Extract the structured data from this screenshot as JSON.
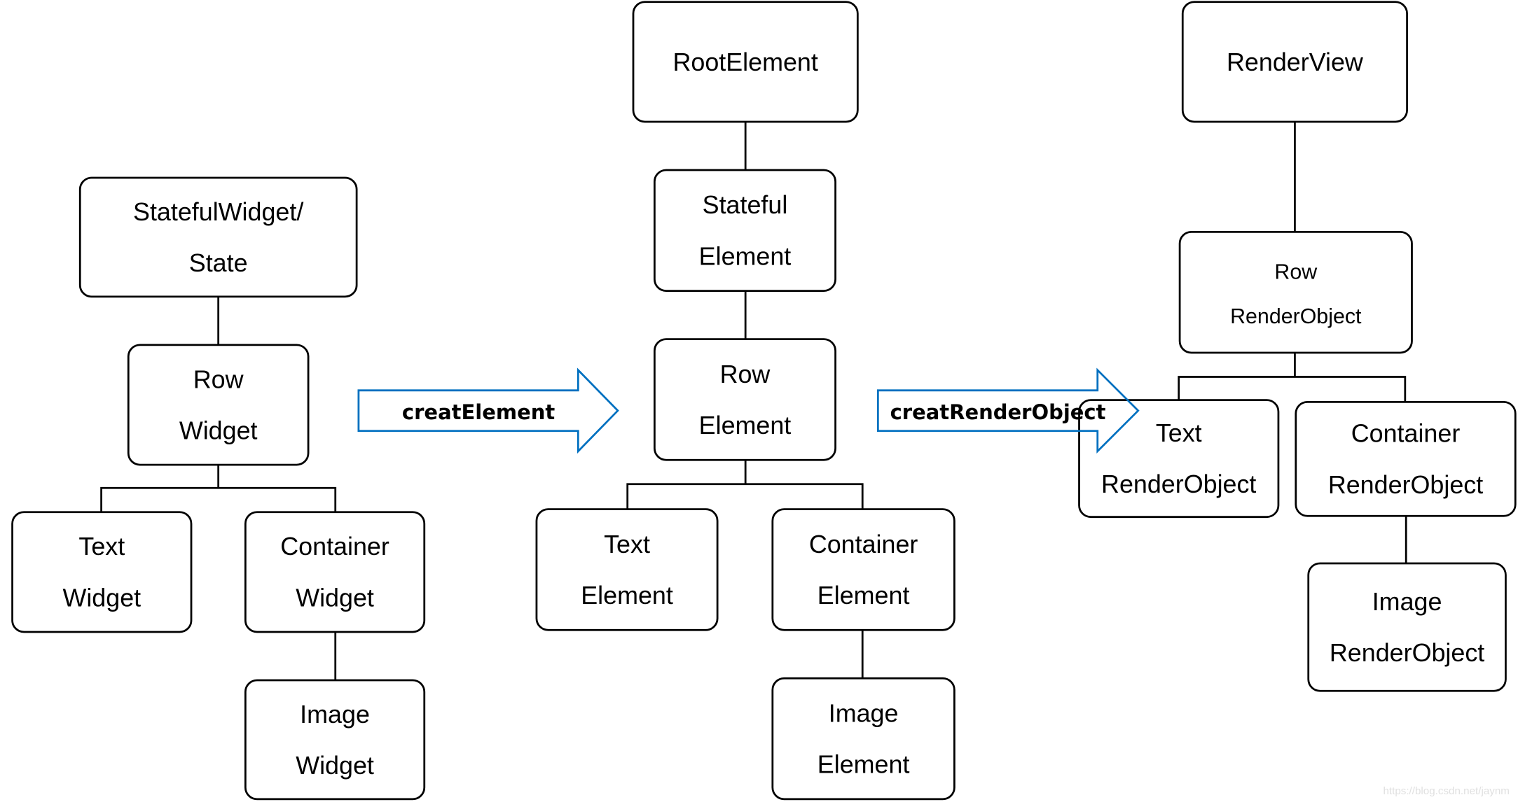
{
  "trees": {
    "widget": [
      {
        "id": "stateful-widget",
        "lines": [
          "StatefulWidget/",
          "State"
        ]
      },
      {
        "id": "row-widget",
        "lines": [
          "Row",
          "Widget"
        ]
      },
      {
        "id": "text-widget",
        "lines": [
          "Text",
          "Widget"
        ]
      },
      {
        "id": "container-widget",
        "lines": [
          "Container",
          "Widget"
        ]
      },
      {
        "id": "image-widget",
        "lines": [
          "Image",
          "Widget"
        ]
      }
    ],
    "element": [
      {
        "id": "root-element",
        "lines": [
          "RootElement"
        ]
      },
      {
        "id": "stateful-element",
        "lines": [
          "Stateful",
          "Element"
        ]
      },
      {
        "id": "row-element",
        "lines": [
          "Row",
          "Element"
        ]
      },
      {
        "id": "text-element",
        "lines": [
          "Text",
          "Element"
        ]
      },
      {
        "id": "container-element",
        "lines": [
          "Container",
          "Element"
        ]
      },
      {
        "id": "image-element",
        "lines": [
          "Image",
          "Element"
        ]
      }
    ],
    "render": [
      {
        "id": "render-view",
        "lines": [
          "RenderView"
        ]
      },
      {
        "id": "row-renderobject",
        "lines": [
          "Row",
          "RenderObject"
        ]
      },
      {
        "id": "text-renderobject",
        "lines": [
          "Text",
          "RenderObject"
        ]
      },
      {
        "id": "container-renderobject",
        "lines": [
          "Container",
          "RenderObject"
        ]
      },
      {
        "id": "image-renderobject",
        "lines": [
          "Image",
          "RenderObject"
        ]
      }
    ]
  },
  "arrows": {
    "create_element": "creatElement",
    "create_render_object": "creatRenderObject",
    "color": "#0070c0"
  },
  "watermark": "https://blog.csdn.net/jaynm"
}
